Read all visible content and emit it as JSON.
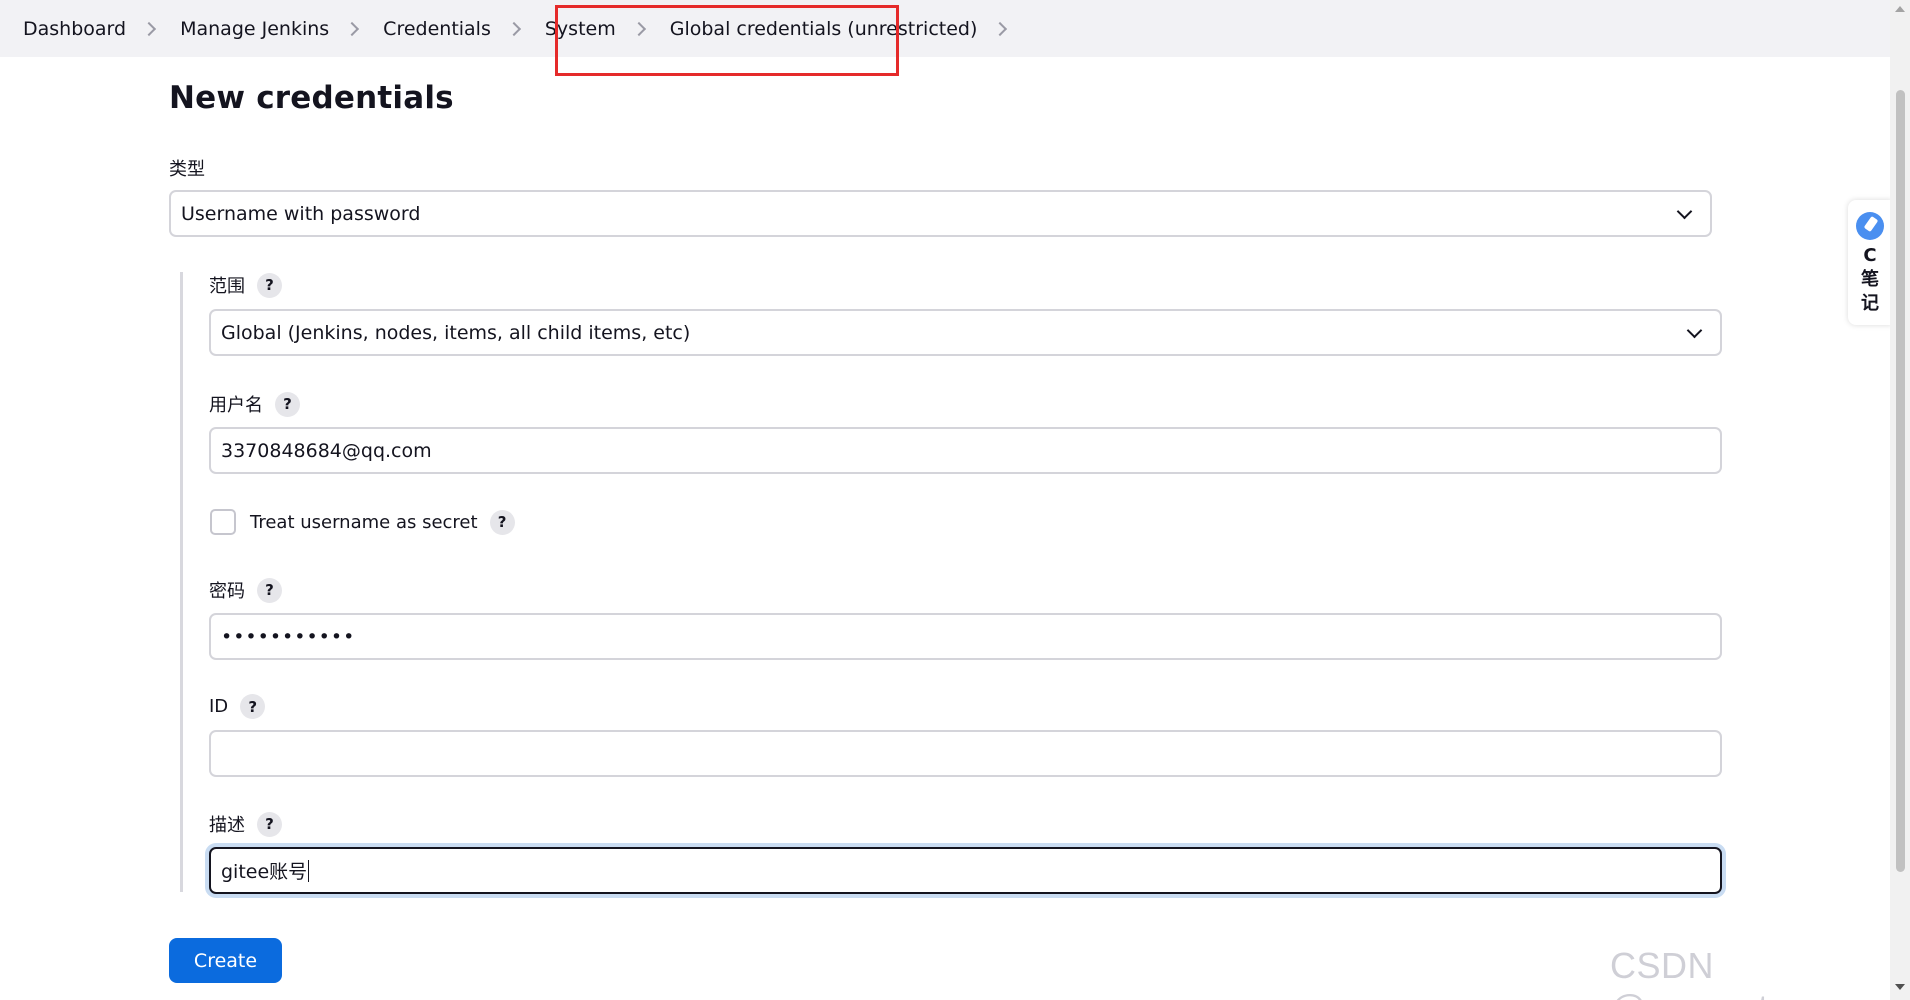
{
  "breadcrumb": {
    "items": [
      {
        "label": "Dashboard"
      },
      {
        "label": "Manage Jenkins"
      },
      {
        "label": "Credentials"
      },
      {
        "label": "System"
      },
      {
        "label": "Global credentials (unrestricted)"
      }
    ]
  },
  "page": {
    "title": "New credentials"
  },
  "form": {
    "kind": {
      "label": "类型",
      "value": "Username with password"
    },
    "scope": {
      "label": "范围",
      "value": "Global (Jenkins, nodes, items, all child items, etc)"
    },
    "username": {
      "label": "用户名",
      "value": "3370848684@qq.com"
    },
    "username_secret": {
      "label": "Treat username as secret",
      "checked": false
    },
    "password": {
      "label": "密码",
      "value": "•••••••••••"
    },
    "id": {
      "label": "ID",
      "value": ""
    },
    "description": {
      "label": "描述",
      "value": "gitee账号"
    },
    "help_glyph": "?"
  },
  "actions": {
    "create_label": "Create"
  },
  "side_widget": {
    "text": "C笔记"
  },
  "watermark": "CSDN @azoon.top",
  "colors": {
    "primary": "#0b6bde",
    "highlight_box": "#e52a2a",
    "breadcrumb_bg": "#f2f2f5"
  },
  "icons": {
    "breadcrumb_separator": "chevron-right-icon",
    "dropdown": "chevron-down-icon",
    "help": "help-icon"
  }
}
